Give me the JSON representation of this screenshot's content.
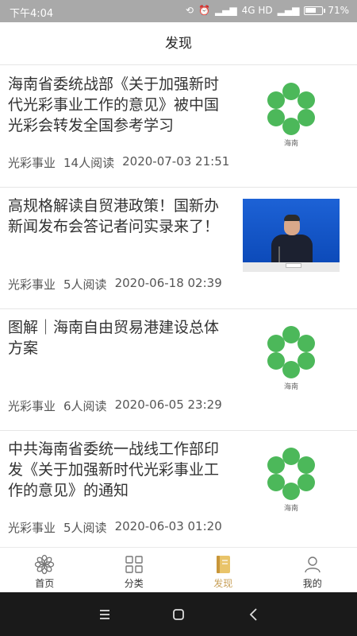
{
  "status_bar": {
    "time": "下午4:04",
    "network": "4G HD",
    "battery": "71%",
    "battery_level": 0.71
  },
  "header": {
    "title": "发现"
  },
  "articles": [
    {
      "title": "海南省委统战部《关于加强新时代光彩事业工作的意见》被中国光彩会转发全国参考学习",
      "source": "光彩事业",
      "reads": "14人阅读",
      "date": "2020-07-03 21:51",
      "thumbnail": "hainan-logo",
      "logo_text": "海南"
    },
    {
      "title": "高规格解读自贸港政策！国新办新闻发布会答记者问实录来了！",
      "source": "光彩事业",
      "reads": "5人阅读",
      "date": "2020-06-18 02:39",
      "thumbnail": "press-conference-photo"
    },
    {
      "title": "图解｜海南自由贸易港建设总体方案",
      "source": "光彩事业",
      "reads": "6人阅读",
      "date": "2020-06-05 23:29",
      "thumbnail": "hainan-logo",
      "logo_text": "海南"
    },
    {
      "title": "中共海南省委统一战线工作部印发《关于加强新时代光彩事业工作的意见》的通知",
      "source": "光彩事业",
      "reads": "5人阅读",
      "date": "2020-06-03 01:20",
      "thumbnail": "hainan-logo",
      "logo_text": "海南"
    }
  ],
  "bottom_nav": [
    {
      "label": "首页",
      "icon": "flower-icon"
    },
    {
      "label": "分类",
      "icon": "grid-icon"
    },
    {
      "label": "发现",
      "icon": "book-icon",
      "active": true
    },
    {
      "label": "我的",
      "icon": "person-icon"
    }
  ],
  "colors": {
    "status_bar": "#a9a9a9",
    "logo_green": "#4cb85a",
    "active_nav": "#c8a15a",
    "system_nav": "#1a1a1a"
  }
}
